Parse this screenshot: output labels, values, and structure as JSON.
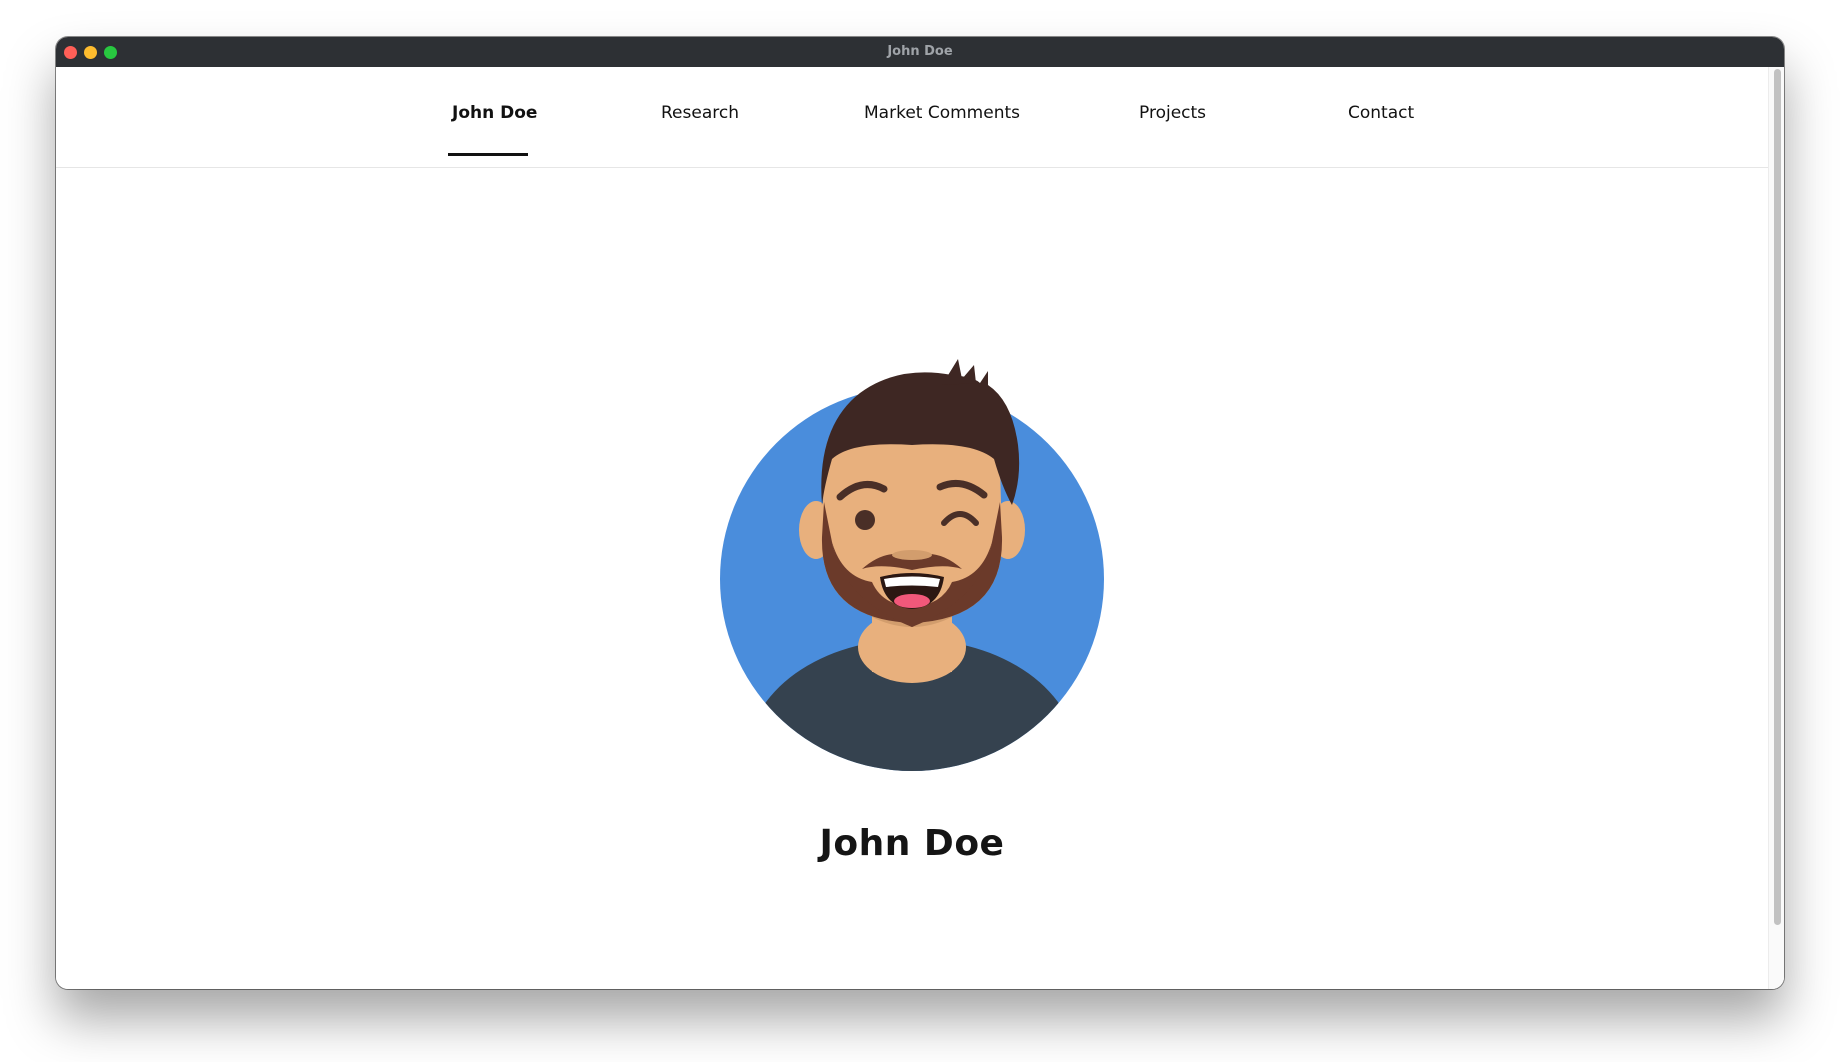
{
  "window": {
    "title": "John Doe"
  },
  "nav": {
    "items": [
      {
        "label": "John Doe",
        "active": true
      },
      {
        "label": "Research",
        "active": false
      },
      {
        "label": "Market Comments",
        "active": false
      },
      {
        "label": "Projects",
        "active": false
      },
      {
        "label": "Contact",
        "active": false
      }
    ]
  },
  "profile": {
    "name": "John Doe",
    "avatar_icon": "winking-bearded-man-avatar"
  },
  "colors": {
    "avatar_background": "#4a8ddc",
    "shirt": "#35424f",
    "skin": "#e8b07d",
    "hair": "#3e2723",
    "beard": "#6b3a2a",
    "titlebar": "#2d3034"
  }
}
